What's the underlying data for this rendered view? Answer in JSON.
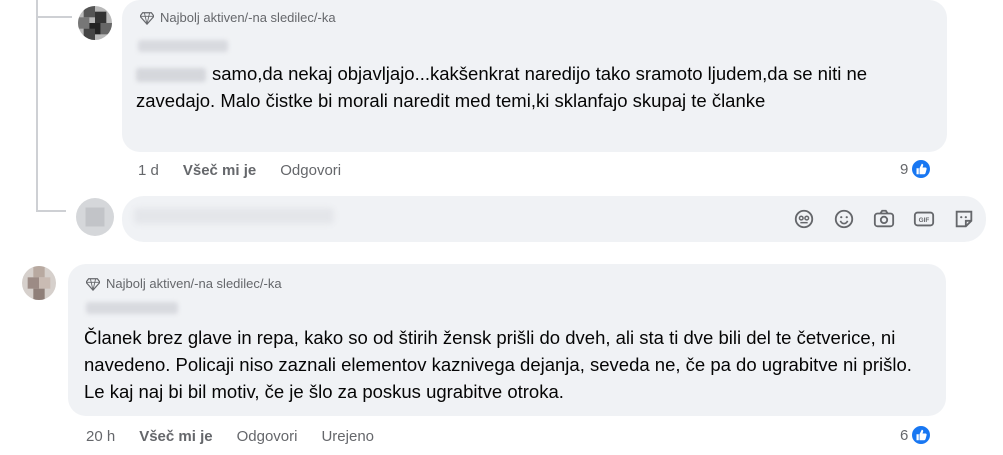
{
  "comments": [
    {
      "badge": "Najbolj aktiven/-na sledilec/-ka",
      "text": "samo,da nekaj objavljajo...kakšenkrat naredijo tako sramoto ljudem,da se niti ne zavedajo. Malo čistke bi morali naredit med temi,ki sklanfajo skupaj te članke",
      "age": "1 d",
      "like_label": "Všeč mi je",
      "reply_label": "Odgovori",
      "reaction_count": "9"
    },
    {
      "badge": "Najbolj aktiven/-na sledilec/-ka",
      "text": "Članek brez glave in repa, kako so od štirih žensk prišli do dveh, ali sta ti dve bili del te četverice, ni navedeno. Policaji niso zaznali elementov kaznivega dejanja, seveda ne, če pa do ugrabitve ni prišlo. Le kaj naj bi bil motiv, če je šlo za poskus ugrabitve otroka.",
      "age": "20 h",
      "like_label": "Všeč mi je",
      "reply_label": "Odgovori",
      "edited_label": "Urejeno",
      "reaction_count": "6"
    }
  ],
  "composer": {
    "icons": [
      "avatar-sticker-icon",
      "emoji-icon",
      "camera-icon",
      "gif-icon",
      "sticker-icon"
    ]
  },
  "colors": {
    "bubble": "#f0f2f5",
    "like_blue": "#1877f2",
    "meta_gray": "#65676b"
  }
}
